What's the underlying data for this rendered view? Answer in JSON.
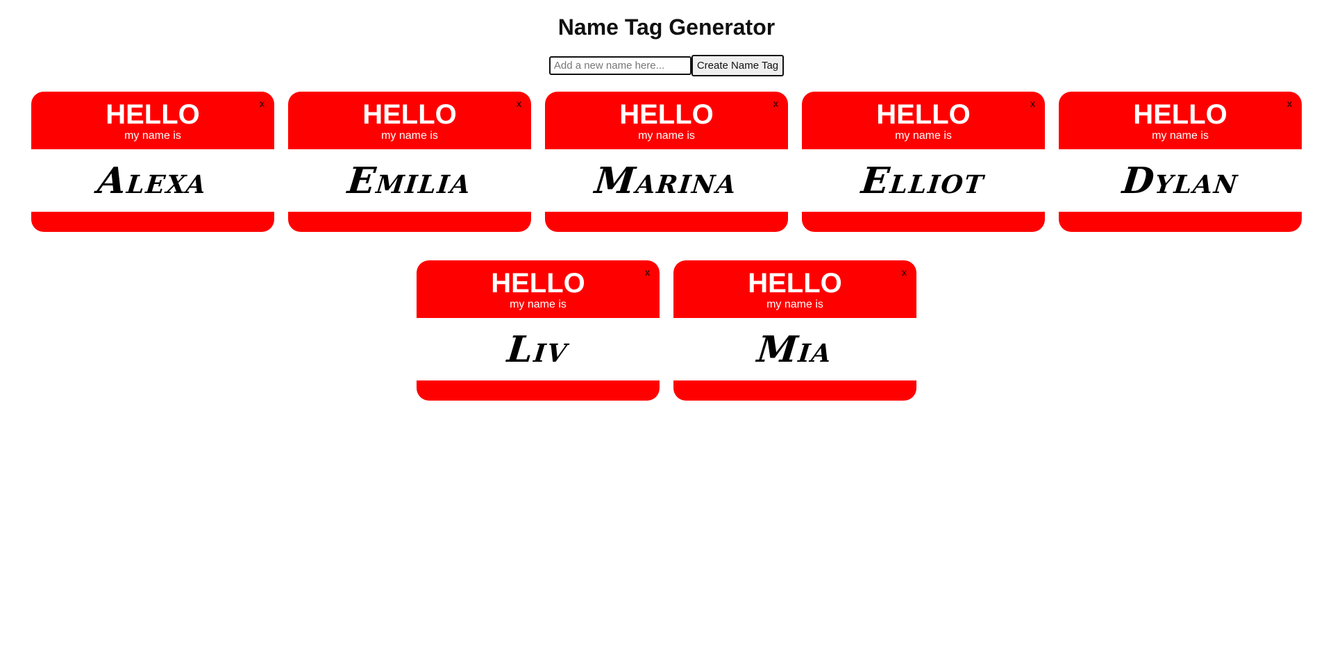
{
  "header": {
    "title": "Name Tag Generator"
  },
  "form": {
    "placeholder": "Add a new name here...",
    "value": "",
    "button_label": "Create Name Tag"
  },
  "tags": [
    {
      "hello": "HELLO",
      "subtitle": "my name is",
      "name": "Alexa",
      "close": "x"
    },
    {
      "hello": "HELLO",
      "subtitle": "my name is",
      "name": "Emilia",
      "close": "x"
    },
    {
      "hello": "HELLO",
      "subtitle": "my name is",
      "name": "Marina",
      "close": "x"
    },
    {
      "hello": "HELLO",
      "subtitle": "my name is",
      "name": "Elliot",
      "close": "x"
    },
    {
      "hello": "HELLO",
      "subtitle": "my name is",
      "name": "Dylan",
      "close": "x"
    },
    {
      "hello": "HELLO",
      "subtitle": "my name is",
      "name": "Liv",
      "close": "x"
    },
    {
      "hello": "HELLO",
      "subtitle": "my name is",
      "name": "Mia",
      "close": "x"
    }
  ],
  "colors": {
    "tag_red": "#ff0000",
    "tag_text": "#ffffff",
    "name_text": "#000000"
  }
}
